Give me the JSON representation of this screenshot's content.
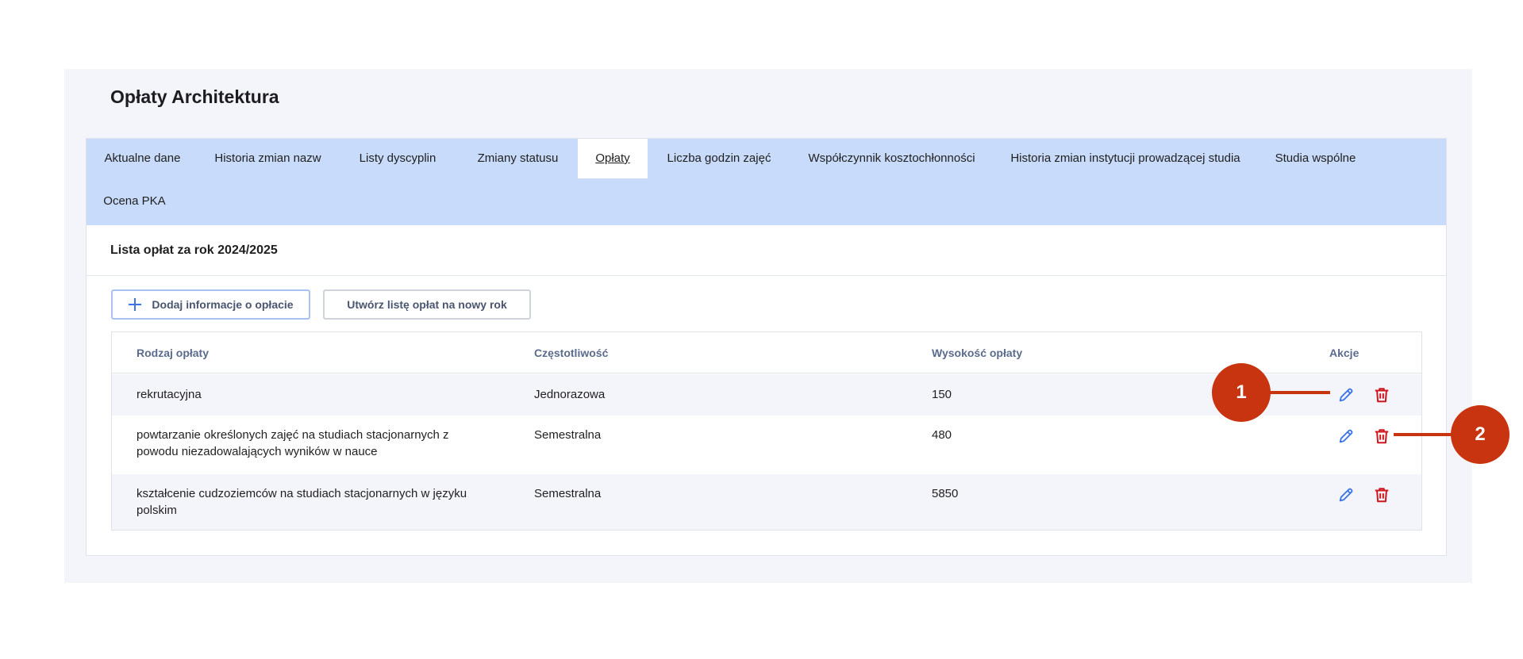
{
  "page": {
    "title": "Opłaty Architektura"
  },
  "tabs": [
    {
      "label": "Aktualne dane"
    },
    {
      "label": "Historia zmian nazw"
    },
    {
      "label": "Listy dyscyplin"
    },
    {
      "label": "Zmiany statusu"
    },
    {
      "label": "Opłaty"
    },
    {
      "label": "Liczba godzin zajęć"
    },
    {
      "label": "Współczynnik kosztochłonności"
    },
    {
      "label": "Historia zmian instytucji prowadzącej studia"
    },
    {
      "label": "Studia wspólne"
    },
    {
      "label": "Ocena PKA"
    }
  ],
  "active_tab": "Opłaty",
  "section": {
    "title": "Lista opłat za rok 2024/2025"
  },
  "buttons": {
    "add_label": "Dodaj informacje o opłacie",
    "new_year_label": "Utwórz listę opłat na nowy rok"
  },
  "table": {
    "headers": {
      "type": "Rodzaj opłaty",
      "frequency": "Częstotliwość",
      "amount": "Wysokość opłaty",
      "actions": "Akcje"
    },
    "rows": [
      {
        "type": "rekrutacyjna",
        "frequency": "Jednorazowa",
        "amount": "150"
      },
      {
        "type": "powtarzanie określonych zajęć na studiach stacjonarnych z powodu niezadowalających wyników w nauce",
        "frequency": "Semestralna",
        "amount": "480"
      },
      {
        "type": "kształcenie cudzoziemców na studiach stacjonarnych w języku polskim",
        "frequency": "Semestralna",
        "amount": "5850"
      }
    ]
  },
  "icons": {
    "edit": "pencil-icon",
    "delete": "trash-icon",
    "add": "plus-icon"
  },
  "callouts": {
    "first": "1",
    "second": "2"
  },
  "colors": {
    "accent": "#3c74e6",
    "danger": "#d0161d",
    "tab_bar": "#c8dbfa",
    "callout": "#c7340f"
  }
}
